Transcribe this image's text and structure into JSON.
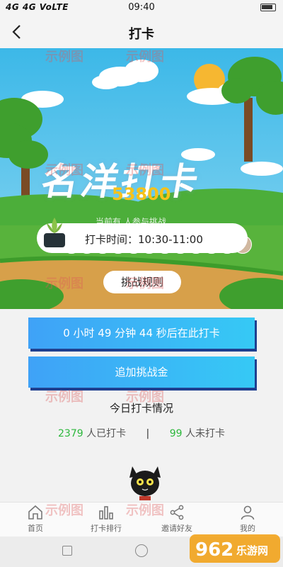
{
  "status_bar": {
    "signal_text": "4G 4G VoLTE",
    "time": "09:40"
  },
  "header": {
    "title": "打卡"
  },
  "hero": {
    "brand_text": "名洋打卡",
    "participant_count": "53800",
    "challenge_text": "当前有 人参与挑战",
    "checkin_time": "打卡时间：10:30-11:00",
    "rules_label": "挑战规则",
    "avatar_colors": [
      "#d9c6b0",
      "#b79070",
      "#c3a07a",
      "#8a9f7d",
      "#c9b28a",
      "#7a6a5a",
      "#222222",
      "#b8a48e",
      "#c7a98c",
      "#a78a74",
      "#cdb6a2",
      "#d1b8a0"
    ]
  },
  "buttons": {
    "countdown": "0 小时 49 分钟 44 秒后在此打卡",
    "add_stake": "追加挑战金"
  },
  "today": {
    "title": "今日打卡情况",
    "checked_count": "2379",
    "checked_label": "人已打卡",
    "separator": "|",
    "unchecked_count": "99",
    "unchecked_label": "人未打卡"
  },
  "tabbar": {
    "items": [
      {
        "label": "首页",
        "icon": "home-icon"
      },
      {
        "label": "打卡排行",
        "icon": "bar-chart-icon"
      },
      {
        "label": "邀请好友",
        "icon": "share-icon"
      },
      {
        "label": "我的",
        "icon": "user-icon"
      }
    ]
  },
  "watermark": {
    "text": "示例图"
  },
  "site_logo": {
    "text": "962.NET 乐游网"
  }
}
